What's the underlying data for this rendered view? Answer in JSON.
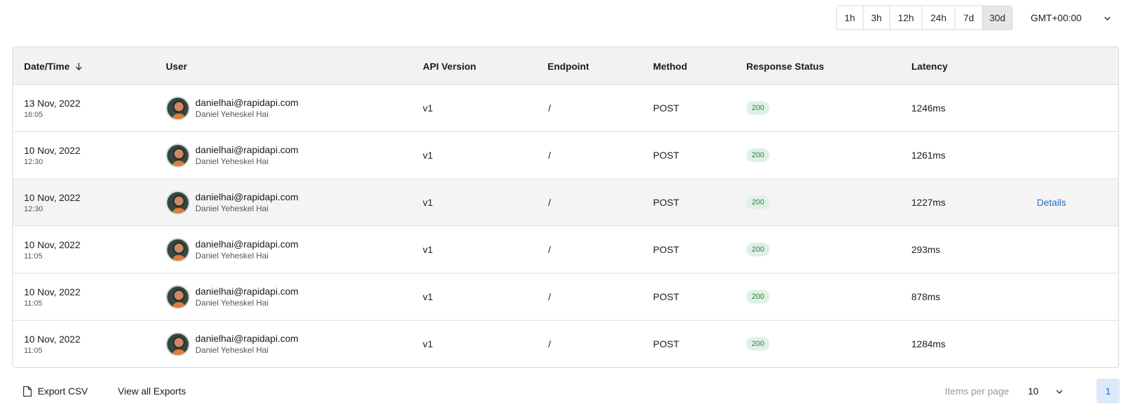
{
  "time_ranges": {
    "options": [
      "1h",
      "3h",
      "12h",
      "24h",
      "7d",
      "30d"
    ],
    "selected": "30d"
  },
  "timezone": {
    "value": "GMT+00:00"
  },
  "table": {
    "headers": {
      "datetime": "Date/Time",
      "user": "User",
      "api_version": "API Version",
      "endpoint": "Endpoint",
      "method": "Method",
      "response_status": "Response Status",
      "latency": "Latency"
    },
    "rows": [
      {
        "date": "13 Nov, 2022",
        "time": "16:05",
        "email": "danielhai@rapidapi.com",
        "name": "Daniel Yeheskel Hai",
        "api_version": "v1",
        "endpoint": "/",
        "method": "POST",
        "status": "200",
        "latency": "1246ms",
        "details": ""
      },
      {
        "date": "10 Nov, 2022",
        "time": "12:30",
        "email": "danielhai@rapidapi.com",
        "name": "Daniel Yeheskel Hai",
        "api_version": "v1",
        "endpoint": "/",
        "method": "POST",
        "status": "200",
        "latency": "1261ms",
        "details": ""
      },
      {
        "date": "10 Nov, 2022",
        "time": "12:30",
        "email": "danielhai@rapidapi.com",
        "name": "Daniel Yeheskel Hai",
        "api_version": "v1",
        "endpoint": "/",
        "method": "POST",
        "status": "200",
        "latency": "1227ms",
        "details": "Details"
      },
      {
        "date": "10 Nov, 2022",
        "time": "11:05",
        "email": "danielhai@rapidapi.com",
        "name": "Daniel Yeheskel Hai",
        "api_version": "v1",
        "endpoint": "/",
        "method": "POST",
        "status": "200",
        "latency": "293ms",
        "details": ""
      },
      {
        "date": "10 Nov, 2022",
        "time": "11:05",
        "email": "danielhai@rapidapi.com",
        "name": "Daniel Yeheskel Hai",
        "api_version": "v1",
        "endpoint": "/",
        "method": "POST",
        "status": "200",
        "latency": "878ms",
        "details": ""
      },
      {
        "date": "10 Nov, 2022",
        "time": "11:05",
        "email": "danielhai@rapidapi.com",
        "name": "Daniel Yeheskel Hai",
        "api_version": "v1",
        "endpoint": "/",
        "method": "POST",
        "status": "200",
        "latency": "1284ms",
        "details": ""
      }
    ]
  },
  "footer": {
    "export_csv": "Export CSV",
    "view_all_exports": "View all Exports",
    "items_per_page_label": "Items per page",
    "items_per_page_value": "10",
    "current_page": "1"
  },
  "colors": {
    "status_badge_bg": "#dff1e4",
    "status_badge_text": "#2e7d44",
    "link": "#1e6fcf",
    "active_range_bg": "#e6e6e6"
  }
}
